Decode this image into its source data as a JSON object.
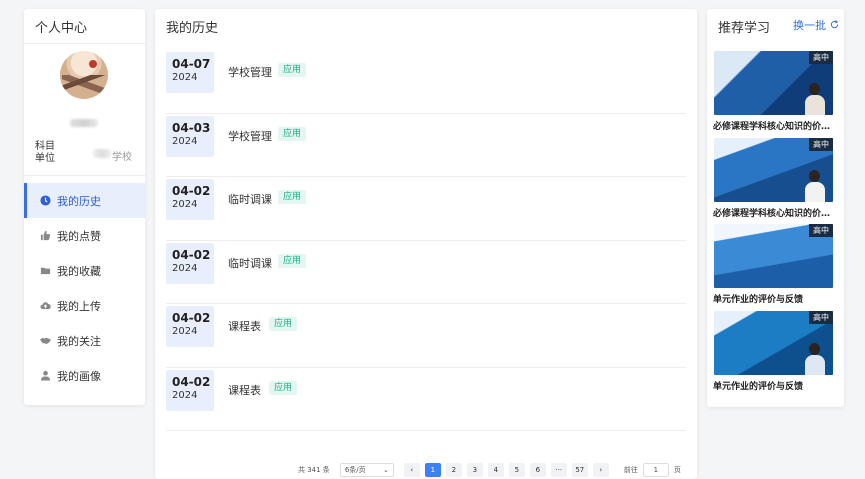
{
  "profile": {
    "title": "个人中心",
    "subject_label": "科目",
    "unit_label": "单位",
    "unit_value_suffix": "学校"
  },
  "menu": [
    {
      "label": "我的历史",
      "icon": "clock-icon",
      "active": true
    },
    {
      "label": "我的点赞",
      "icon": "thumbs-up-icon",
      "active": false
    },
    {
      "label": "我的收藏",
      "icon": "folder-icon",
      "active": false
    },
    {
      "label": "我的上传",
      "icon": "cloud-upload-icon",
      "active": false
    },
    {
      "label": "我的关注",
      "icon": "handshake-icon",
      "active": false
    },
    {
      "label": "我的画像",
      "icon": "user-icon",
      "active": false
    }
  ],
  "history": {
    "title": "我的历史",
    "rows": [
      {
        "md": "04-07",
        "year": "2024",
        "name": "学校管理",
        "tag": "应用"
      },
      {
        "md": "04-03",
        "year": "2024",
        "name": "学校管理",
        "tag": "应用"
      },
      {
        "md": "04-02",
        "year": "2024",
        "name": "临时调课",
        "tag": "应用"
      },
      {
        "md": "04-02",
        "year": "2024",
        "name": "临时调课",
        "tag": "应用"
      },
      {
        "md": "04-02",
        "year": "2024",
        "name": "课程表",
        "tag": "应用"
      },
      {
        "md": "04-02",
        "year": "2024",
        "name": "课程表",
        "tag": "应用"
      }
    ]
  },
  "pagination": {
    "total": "共 341 条",
    "page_size": "6条/页",
    "prev": "‹",
    "next": "›",
    "pages": [
      "1",
      "2",
      "3",
      "4",
      "5",
      "6",
      "···",
      "57"
    ],
    "current": "1",
    "goto_prefix": "前往",
    "goto_value": "1",
    "goto_suffix": "页"
  },
  "recommend": {
    "title": "推荐学习",
    "refresh_label": "换一批",
    "items": [
      {
        "badge": "高中",
        "title": "必修课程学科核心知识的价值...",
        "bg": "#1f5fa8"
      },
      {
        "badge": "高中",
        "title": "必修课程学科核心知识的价值...",
        "bg": "#2a76c4"
      },
      {
        "badge": "高中",
        "title": "单元作业的评价与反馈",
        "bg": "#3b8ad6"
      },
      {
        "badge": "高中",
        "title": "单元作业的评价与反馈",
        "bg": "#1c7cc4"
      }
    ]
  },
  "colors": {
    "accent": "#3b6fe0",
    "tag_green": "#1fae8a",
    "active_bg": "#e8eefb"
  }
}
